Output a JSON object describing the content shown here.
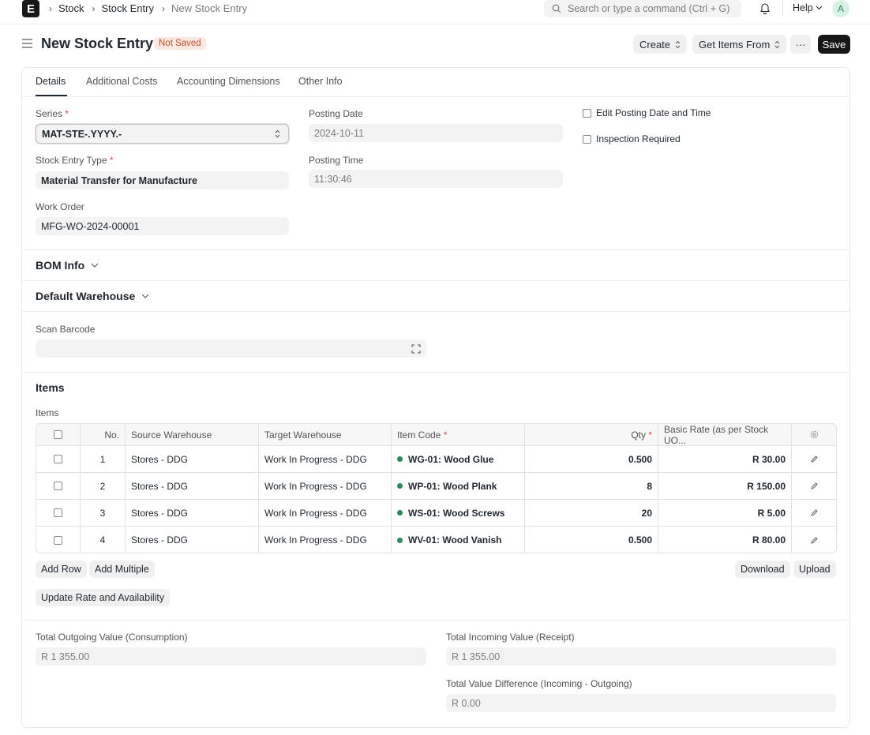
{
  "navbar": {
    "logo": "E",
    "breadcrumbs": [
      "Stock",
      "Stock Entry",
      "New Stock Entry"
    ],
    "search_placeholder": "Search or type a command (Ctrl + G)",
    "help_label": "Help",
    "avatar_initial": "A"
  },
  "page": {
    "title": "New Stock Entry",
    "status": "Not Saved",
    "actions": {
      "create": "Create",
      "get_items_from": "Get Items From",
      "more": "···",
      "save": "Save"
    }
  },
  "tabs": [
    "Details",
    "Additional Costs",
    "Accounting Dimensions",
    "Other Info"
  ],
  "details": {
    "series_label": "Series",
    "series_value": "MAT-STE-.YYYY.-",
    "stock_entry_type_label": "Stock Entry Type",
    "stock_entry_type_value": "Material Transfer for Manufacture",
    "work_order_label": "Work Order",
    "work_order_value": "MFG-WO-2024-00001",
    "posting_date_label": "Posting Date",
    "posting_date_value": "2024-10-11",
    "posting_time_label": "Posting Time",
    "posting_time_value": "11:30:46",
    "edit_posting_label": "Edit Posting Date and Time",
    "inspection_label": "Inspection Required",
    "required_mark": "*"
  },
  "sections": {
    "bom_info": "BOM Info",
    "default_warehouse": "Default Warehouse",
    "scan_barcode_label": "Scan Barcode",
    "items_title": "Items",
    "items_label": "Items"
  },
  "items_table": {
    "headers": {
      "no": "No.",
      "source": "Source Warehouse",
      "target": "Target Warehouse",
      "item_code": "Item Code",
      "qty": "Qty",
      "rate": "Basic Rate (as per Stock UO..."
    },
    "rows": [
      {
        "no": "1",
        "source": "Stores - DDG",
        "target": "Work In Progress - DDG",
        "item_code": "WG-01: Wood Glue",
        "qty": "0.500",
        "rate": "R 30.00"
      },
      {
        "no": "2",
        "source": "Stores - DDG",
        "target": "Work In Progress - DDG",
        "item_code": "WP-01: Wood Plank",
        "qty": "8",
        "rate": "R 150.00"
      },
      {
        "no": "3",
        "source": "Stores - DDG",
        "target": "Work In Progress - DDG",
        "item_code": "WS-01: Wood Screws",
        "qty": "20",
        "rate": "R 5.00"
      },
      {
        "no": "4",
        "source": "Stores - DDG",
        "target": "Work In Progress - DDG",
        "item_code": "WV-01: Wood Vanish",
        "qty": "0.500",
        "rate": "R 80.00"
      }
    ],
    "buttons": {
      "add_row": "Add Row",
      "add_multiple": "Add Multiple",
      "download": "Download",
      "upload": "Upload",
      "update_rate": "Update Rate and Availability"
    }
  },
  "totals": {
    "outgoing_label": "Total Outgoing Value (Consumption)",
    "outgoing_value": "R 1 355.00",
    "incoming_label": "Total Incoming Value (Receipt)",
    "incoming_value": "R 1 355.00",
    "difference_label": "Total Value Difference (Incoming - Outgoing)",
    "difference_value": "R 0.00"
  },
  "colors": {
    "primary_button": "#171717",
    "status_badge_bg": "#fde8e1",
    "status_badge_text": "#cc4e2f",
    "item_dot": "#2d8a57"
  }
}
